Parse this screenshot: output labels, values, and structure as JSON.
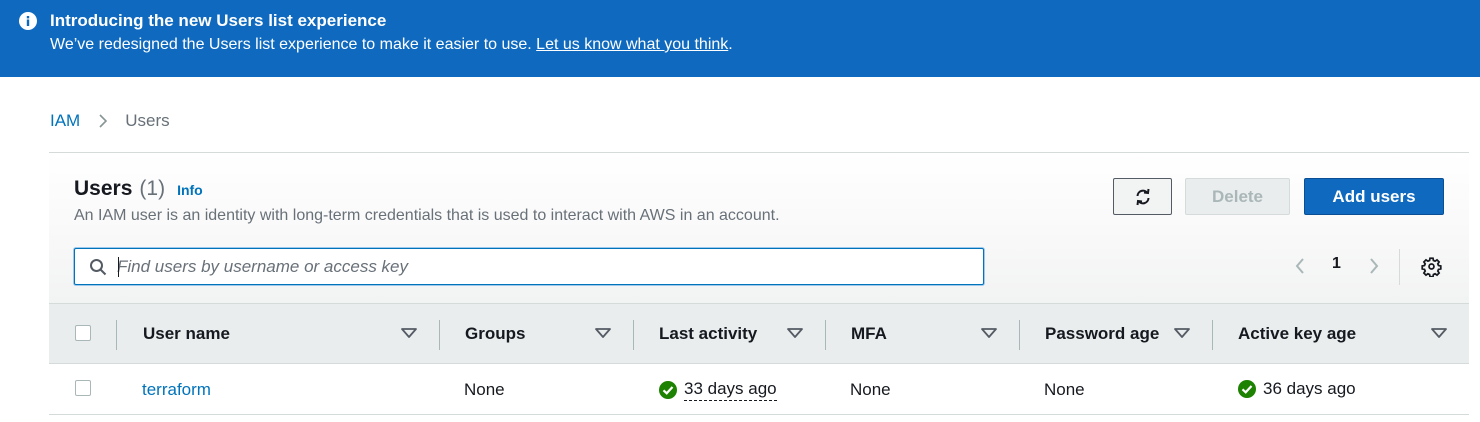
{
  "banner": {
    "title": "Introducing the new Users list experience",
    "text": "We’ve redesigned the Users list experience to make it easier to use.",
    "link": "Let us know what you think",
    "suffix": "."
  },
  "breadcrumb": {
    "root": "IAM",
    "current": "Users"
  },
  "header": {
    "title": "Users",
    "count": "(1)",
    "info": "Info",
    "description": "An IAM user is an identity with long-term credentials that is used to interact with AWS in an account."
  },
  "actions": {
    "refresh_icon": "refresh-icon",
    "delete": "Delete",
    "add": "Add users"
  },
  "search": {
    "placeholder": "Find users by username or access key",
    "value": ""
  },
  "pagination": {
    "current_page": "1"
  },
  "table": {
    "columns": [
      "User name",
      "Groups",
      "Last activity",
      "MFA",
      "Password age",
      "Active key age"
    ],
    "rows": [
      {
        "user_name": "terraform",
        "groups": "None",
        "last_activity": "33 days ago",
        "mfa": "None",
        "password_age": "None",
        "active_key_age": "36 days ago"
      }
    ]
  },
  "colors": {
    "banner": "#0f6abf",
    "link": "#0073bb",
    "success": "#1d8102",
    "primary_button": "#0f6abf"
  }
}
